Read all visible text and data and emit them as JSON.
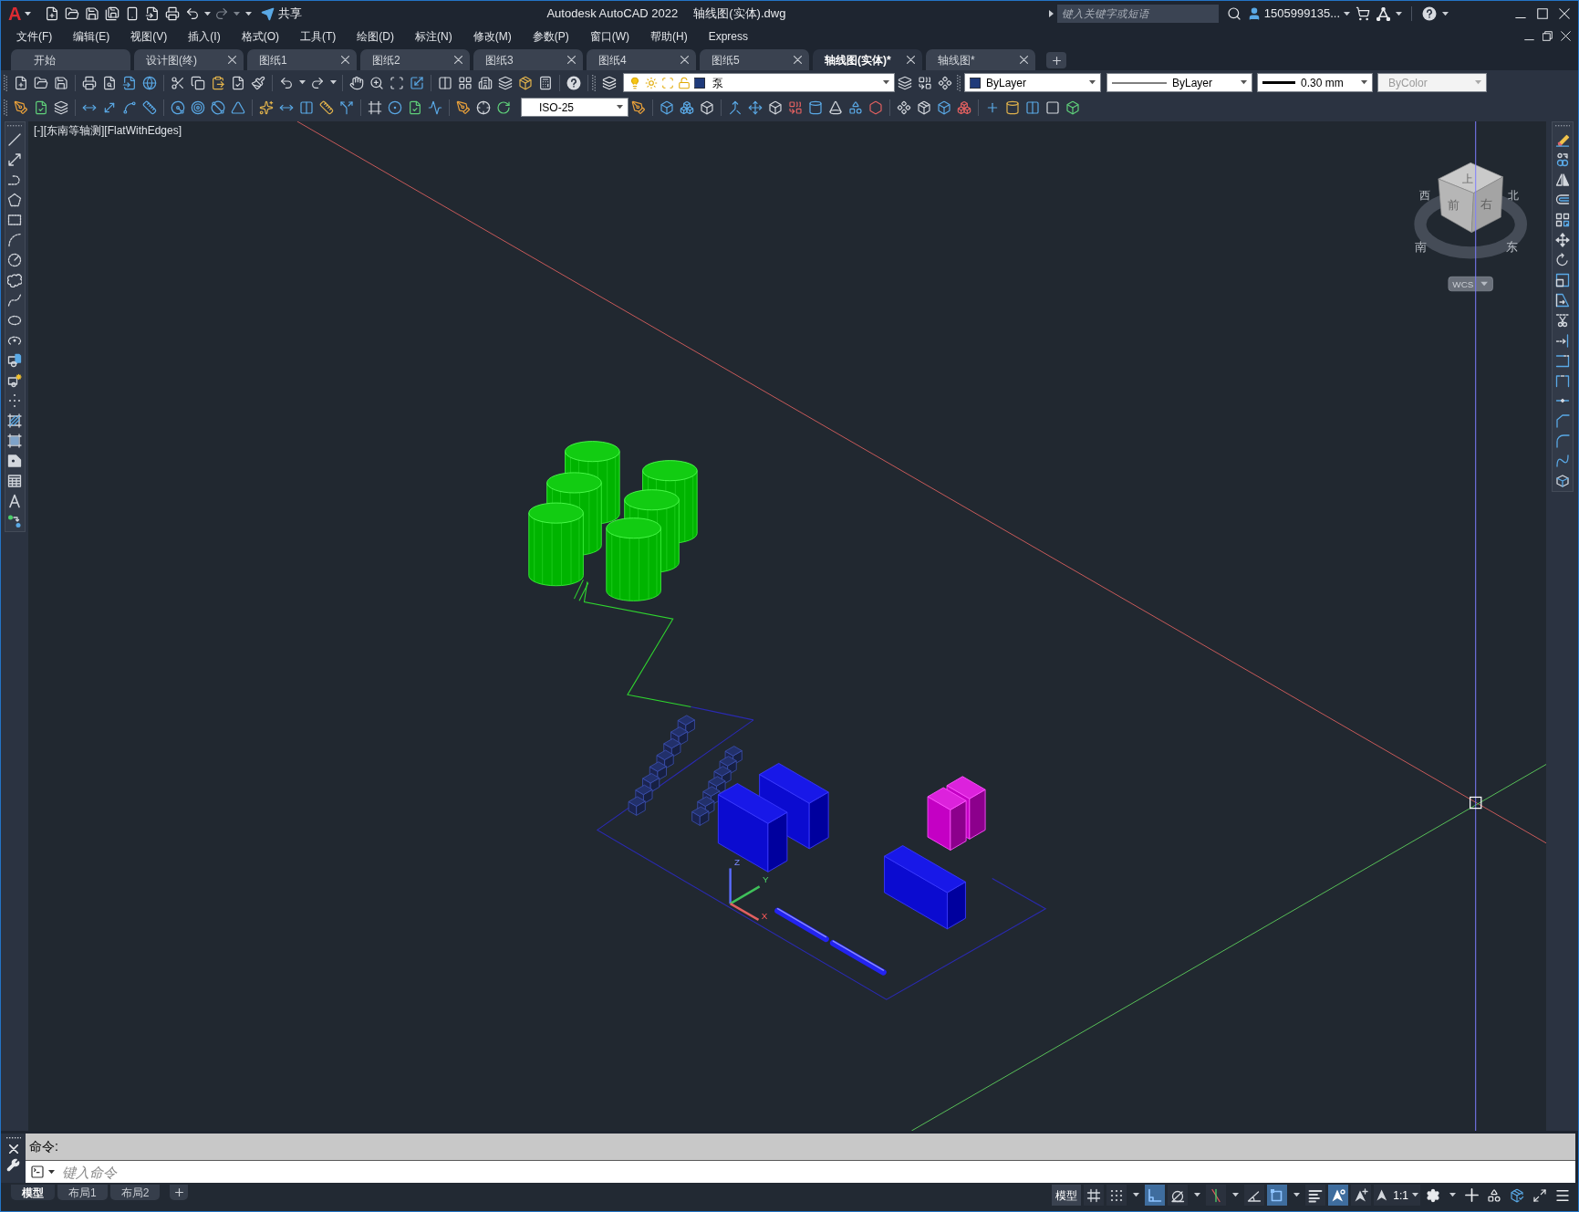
{
  "title_bar": {
    "app_button": "A",
    "share_label": "共享",
    "app_title": "Autodesk AutoCAD 2022",
    "document_title": "轴线图(实体).dwg",
    "search": {
      "placeholder": "键入关键字或短语"
    },
    "user_name": "1505999135..."
  },
  "menu_bar": [
    "文件(F)",
    "编辑(E)",
    "视图(V)",
    "插入(I)",
    "格式(O)",
    "工具(T)",
    "绘图(D)",
    "标注(N)",
    "修改(M)",
    "参数(P)",
    "窗口(W)",
    "帮助(H)",
    "Express"
  ],
  "file_tabs": [
    {
      "label": "开始",
      "selected": false,
      "closable": false
    },
    {
      "label": "设计图(终)",
      "selected": false,
      "closable": true
    },
    {
      "label": "图纸1",
      "selected": false,
      "closable": true
    },
    {
      "label": "图纸2",
      "selected": false,
      "closable": true
    },
    {
      "label": "图纸3",
      "selected": false,
      "closable": true
    },
    {
      "label": "图纸4",
      "selected": false,
      "closable": true
    },
    {
      "label": "图纸5",
      "selected": false,
      "closable": true
    },
    {
      "label": "轴线图(实体)*",
      "selected": true,
      "closable": true
    },
    {
      "label": "轴线图*",
      "selected": false,
      "closable": true
    }
  ],
  "properties_toolbar": {
    "layer": {
      "name": "泵",
      "on": true,
      "frozen": false,
      "locked": false
    },
    "color_control": "ByLayer",
    "linetype": "ByLayer",
    "lineweight": "0.30 mm",
    "plot_style": {
      "value": "ByColor",
      "disabled": true
    }
  },
  "dimension_toolbar": {
    "dim_style": "ISO-25"
  },
  "viewport": {
    "controls": [
      "[-]",
      "[东南等轴测]",
      "[FlatWithEdges]"
    ],
    "viewcube": {
      "top": "上",
      "front": "前",
      "right": "右",
      "compass": {
        "north": "北",
        "south": "南",
        "east": "东",
        "west": "西"
      },
      "ucs_menu": "WCS"
    },
    "ucs_axes": {
      "x": "X",
      "y": "Y",
      "z": "Z"
    }
  },
  "command_line": {
    "history": "命令:",
    "placeholder": "键入命令"
  },
  "layout_tabs": [
    {
      "label": "模型",
      "selected": true
    },
    {
      "label": "布局1",
      "selected": false
    },
    {
      "label": "布局2",
      "selected": false
    }
  ],
  "status_bar": {
    "space_button": "模型",
    "toggles": [
      {
        "kind": "grid",
        "on": false
      },
      {
        "kind": "snap",
        "on": false
      },
      {
        "kind": "ortho",
        "on": true
      },
      {
        "kind": "polar",
        "on": false
      },
      {
        "kind": "isodraft",
        "on": false
      },
      {
        "kind": "osnaptrack",
        "on": false
      },
      {
        "kind": "osnap",
        "on": true
      },
      {
        "kind": "lineweight",
        "on": false
      },
      {
        "kind": "annovisibility",
        "on": true
      },
      {
        "kind": "autoscale",
        "on": false
      }
    ],
    "annotation_scale": "1:1"
  }
}
